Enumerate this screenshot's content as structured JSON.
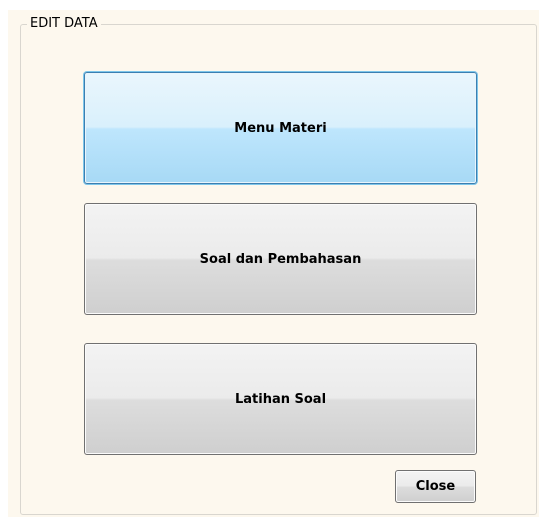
{
  "group": {
    "title": "EDIT DATA"
  },
  "buttons": [
    {
      "label": "Menu Materi",
      "focused": true
    },
    {
      "label": "Soal dan Pembahasan",
      "focused": false
    },
    {
      "label": "Latihan Soal",
      "focused": false
    }
  ],
  "close_label": "Close",
  "colors": {
    "panel_background": "#fdf8ee",
    "focused_button": "#bee6fd",
    "button_face": "#ebebeb"
  }
}
